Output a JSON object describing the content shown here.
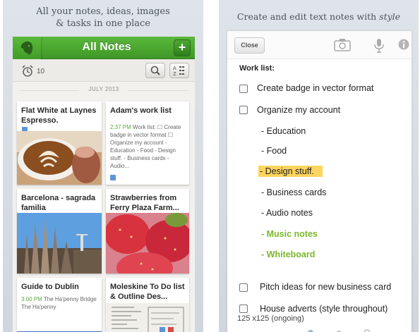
{
  "left": {
    "caption_line1": "All your notes, ideas, images",
    "caption_line2": "& tasks in one place",
    "header": {
      "title": "All Notes",
      "add_label": "+"
    },
    "reminder_count": "10",
    "month": "JULY 2013",
    "notes": [
      {
        "title": "Flat White at Laynes Espresso."
      },
      {
        "title": "Adam's work list",
        "time": "2:37 PM",
        "snippet": "Work list: ☐ Create badge in vector format ☐ Organize my account - Education - Food - Design stuff. - Business cards - Audio..."
      },
      {
        "title": "Barcelona - sagrada familia"
      },
      {
        "title": "Strawberries from Ferry Plaza Farm..."
      },
      {
        "title": "Guide to Dublin",
        "time": "3:00 PM",
        "snippet": "The Ha'penny Bridge The Ha'penny"
      },
      {
        "title": "Moleskine To Do list & Outline Des..."
      }
    ]
  },
  "right": {
    "caption_prefix": "Create and edit text notes with ",
    "caption_emph": "style",
    "close_label": "Close",
    "heading": "Work list:",
    "items": [
      {
        "text": "Create badge in vector format"
      },
      {
        "text": "Organize my account"
      },
      {
        "text": "- Education"
      },
      {
        "text": "- Food"
      },
      {
        "text": "- Design stuff."
      },
      {
        "text": "- Business cards"
      },
      {
        "text": "- Audio notes"
      },
      {
        "text": "- Music notes"
      },
      {
        "text": "- Whiteboard"
      },
      {
        "text": "Pitch ideas for new business card"
      },
      {
        "text": "House adverts (style throughout)"
      },
      {
        "text": "125 x125 (ongoing)"
      }
    ],
    "colors": {
      "highlight": "#fcd45e",
      "green": "#7cb82a",
      "brand": "#4aa82e"
    }
  }
}
